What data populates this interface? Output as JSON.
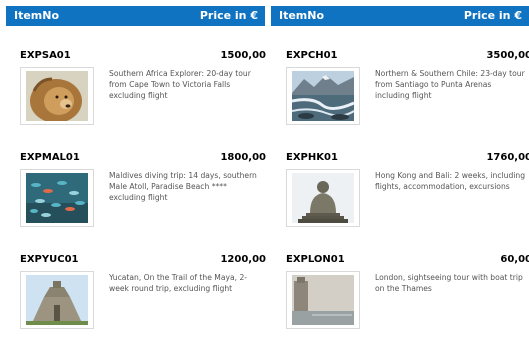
{
  "header": {
    "col_item": "ItemNo",
    "col_price": "Price in €"
  },
  "products": [
    {
      "code": "EXPSA01",
      "price": "1500,00",
      "desc": "Southern Africa Explorer: 20-day tour from Cape Town to Victoria Falls excluding flight",
      "image": "lion-photo"
    },
    {
      "code": "EXPCH01",
      "price": "3500,00",
      "desc": "Northern & Southern Chile: 23-day tour from Santiago to Punta Arenas including flight",
      "image": "river-photo"
    },
    {
      "code": "EXPMAL01",
      "price": "1800,00",
      "desc": "Maldives diving trip: 14 days, southern Male Atoll, Paradise Beach **** excluding flight",
      "image": "fish-photo"
    },
    {
      "code": "EXPHK01",
      "price": "1760,00",
      "desc": "Hong Kong and Bali: 2 weeks, including flights, accommodation, excursions",
      "image": "buddha-photo"
    },
    {
      "code": "EXPYUC01",
      "price": "1200,00",
      "desc": "Yucatan, On the Trail of the Maya, 2-week round trip, excluding flight",
      "image": "pyramid-photo"
    },
    {
      "code": "EXPLON01",
      "price": "60,00",
      "desc": "London, sightseeing tour with boat trip on the Thames",
      "image": "thames-photo"
    }
  ]
}
